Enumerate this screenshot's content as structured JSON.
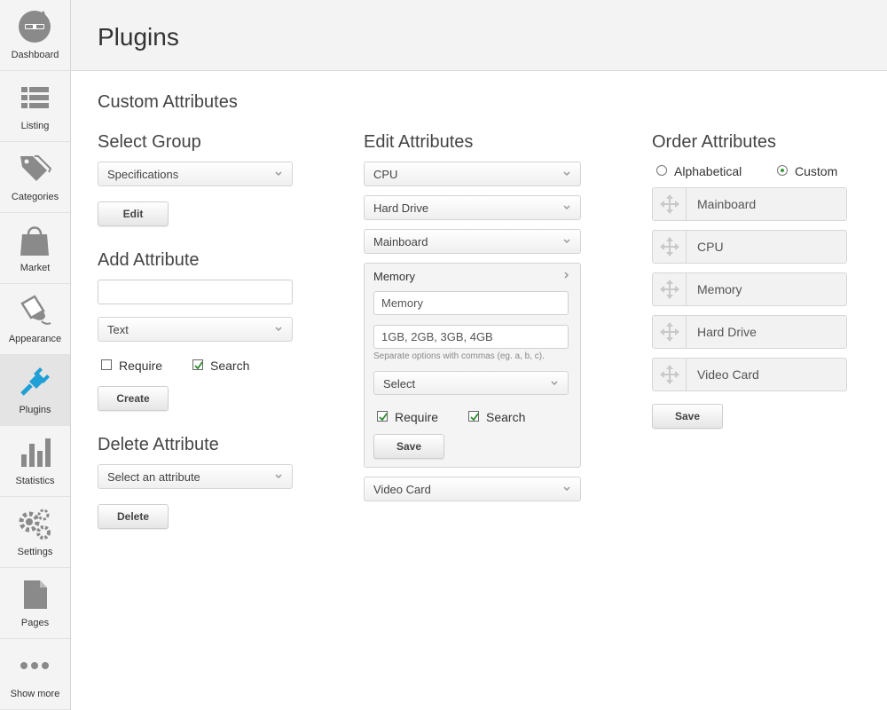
{
  "sidebar": {
    "items": [
      {
        "label": "Dashboard",
        "icon": "dashboard-icon"
      },
      {
        "label": "Listing",
        "icon": "list-icon"
      },
      {
        "label": "Categories",
        "icon": "tag-icon"
      },
      {
        "label": "Market",
        "icon": "shopping-bag-icon"
      },
      {
        "label": "Appearance",
        "icon": "paint-bucket-icon"
      },
      {
        "label": "Plugins",
        "icon": "plug-icon"
      },
      {
        "label": "Statistics",
        "icon": "bar-chart-icon"
      },
      {
        "label": "Settings",
        "icon": "gears-icon"
      },
      {
        "label": "Pages",
        "icon": "page-icon"
      },
      {
        "label": "Show more",
        "icon": "more-dots-icon"
      }
    ],
    "active": "Plugins",
    "accent_color": "#1f9fd6"
  },
  "header": {
    "title": "Plugins"
  },
  "main": {
    "title": "Custom Attributes",
    "select_group": {
      "title": "Select Group",
      "value": "Specifications",
      "edit_label": "Edit"
    },
    "add_attribute": {
      "title": "Add Attribute",
      "name_value": "",
      "type_value": "Text",
      "require_label": "Require",
      "require_checked": false,
      "search_label": "Search",
      "search_checked": true,
      "create_label": "Create"
    },
    "delete_attribute": {
      "title": "Delete Attribute",
      "select_value": "Select an attribute",
      "delete_label": "Delete"
    },
    "edit_attributes": {
      "title": "Edit Attributes",
      "collapsed_before": [
        "CPU",
        "Hard Drive",
        "Mainboard"
      ],
      "expanded": {
        "name": "Memory",
        "name_value": "Memory",
        "options_value": "1GB, 2GB, 3GB, 4GB",
        "hint": "Separate options with commas (eg. a, b, c).",
        "type_value": "Select",
        "require_label": "Require",
        "require_checked": true,
        "search_label": "Search",
        "search_checked": true,
        "save_label": "Save"
      },
      "collapsed_after": [
        "Video Card"
      ]
    },
    "order_attributes": {
      "title": "Order Attributes",
      "alphabetical_label": "Alphabetical",
      "custom_label": "Custom",
      "selected": "Custom",
      "items": [
        "Mainboard",
        "CPU",
        "Memory",
        "Hard Drive",
        "Video Card"
      ],
      "save_label": "Save"
    }
  }
}
